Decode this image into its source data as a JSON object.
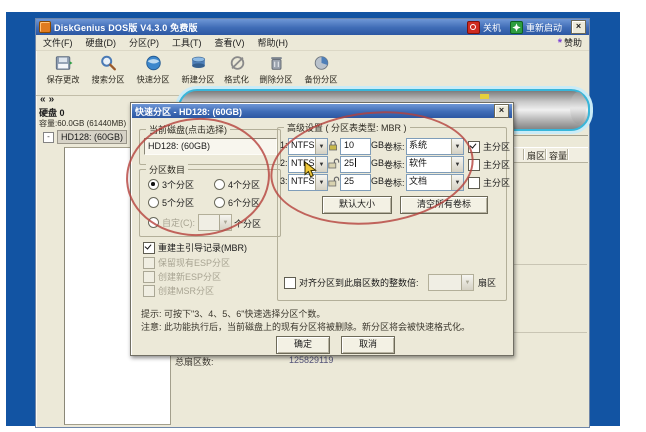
{
  "colors": {
    "desktop_blue": "#1254a3",
    "titlebar_blue": "#3f6cb6",
    "window_bg": "#ece9d8",
    "selection_cyan": "#38b6da",
    "annotation_red": "#b5413c"
  },
  "window": {
    "title": "DiskGenius DOS版 V4.3.0 免费版",
    "controls": {
      "shutdown": "关机",
      "restart": "重新启动",
      "close": "×"
    },
    "menu": {
      "items": [
        "文件(F)",
        "硬盘(D)",
        "分区(P)",
        "工具(T)",
        "查看(V)",
        "帮助(H)"
      ],
      "sponsor_star": "*",
      "sponsor": "赞助"
    },
    "toolbar": [
      {
        "label": "保存更改"
      },
      {
        "label": "搜索分区"
      },
      {
        "label": "快速分区"
      },
      {
        "label": "新建分区"
      },
      {
        "label": "格式化"
      },
      {
        "label": "删除分区"
      },
      {
        "label": "备份分区"
      }
    ],
    "sidebar": {
      "nav_prev": "«",
      "nav_next": "»",
      "disk_name": "硬盘 0",
      "capacity": "容量:60.0GB (61440MB)",
      "tree_expander": "-",
      "tree_label": "HD128: (60GB)"
    },
    "main": {
      "col_sector": "扇区",
      "col_capacity": "容量",
      "total_sectors_label": "总扇区数:",
      "total_sectors_value": "125829119"
    }
  },
  "dialog": {
    "title": "快速分区 - HD128: (60GB)",
    "close": "×",
    "current_disk": {
      "legend": "当前磁盘(点击选择)",
      "value": "HD128: (60GB)"
    },
    "partition_count": {
      "legend": "分区数目",
      "opt3": "3个分区",
      "opt4": "4个分区",
      "opt5": "5个分区",
      "opt6": "6个分区",
      "selected": "3个分区",
      "custom_label": "自定(C):",
      "custom_value": "",
      "custom_suffix": "个分区"
    },
    "options": {
      "rebuild_mbr": "重建主引导记录(MBR)",
      "keep_esp": "保留现有ESP分区",
      "create_esp": "创建新ESP分区",
      "create_msr": "创建MSR分区"
    },
    "advanced": {
      "legend": "高级设置 ( 分区表类型: MBR )",
      "rows": [
        {
          "index": "1:",
          "fs": "NTFS",
          "size": "10",
          "unit": "GB",
          "vol_label": "卷标:",
          "volume": "系统",
          "primary": "主分区",
          "primary_checked": true,
          "locked": true
        },
        {
          "index": "2:",
          "fs": "NTFS",
          "size": "25",
          "unit": "GB",
          "vol_label": "卷标:",
          "volume": "软件",
          "primary": "主分区",
          "primary_checked": false,
          "locked": false
        },
        {
          "index": "3:",
          "fs": "NTFS",
          "size": "25",
          "unit": "GB",
          "vol_label": "卷标:",
          "volume": "文档",
          "primary": "主分区",
          "primary_checked": false,
          "locked": false
        }
      ],
      "default_size_button": "默认大小",
      "clear_labels_button": "清空所有卷标",
      "align_label": "对齐分区到此扇区数的整数倍:",
      "align_value": "",
      "align_unit": "扇区"
    },
    "hint": "提示: 可按下\"3、4、5、6\"快速选择分区个数。",
    "warning": "注意: 此功能执行后，当前磁盘上的现有分区将被删除。新分区将会被快速格式化。",
    "ok_button": "确定",
    "cancel_button": "取消"
  }
}
